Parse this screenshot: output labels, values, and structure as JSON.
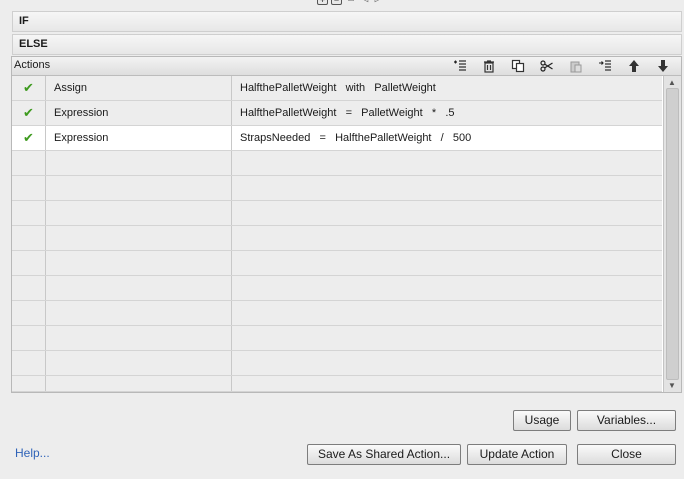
{
  "top_toolbar": {
    "icons": [
      "add-icon",
      "remove-icon",
      "copy-icon",
      "left-arrow-icon",
      "right-arrow-icon"
    ]
  },
  "sections": {
    "if_label": "IF",
    "else_label": "ELSE"
  },
  "actions": {
    "title": "Actions",
    "toolbar_icons": [
      "insert-action-icon",
      "delete-icon",
      "copy-icon",
      "cut-icon",
      "paste-icon",
      "insert-before-icon",
      "move-up-icon",
      "move-down-icon"
    ],
    "rows": [
      {
        "enabled": true,
        "type": "Assign",
        "detail": "HalfthePalletWeight   with   PalletWeight"
      },
      {
        "enabled": true,
        "type": "Expression",
        "detail": "HalfthePalletWeight   =   PalletWeight   *   .5"
      },
      {
        "enabled": true,
        "type": "Expression",
        "detail": "StrapsNeeded   =   HalfthePalletWeight   /   500"
      }
    ],
    "empty_row_count": 10
  },
  "buttons": {
    "usage": "Usage",
    "variables": "Variables...",
    "save_shared": "Save As Shared Action...",
    "update": "Update Action",
    "close": "Close"
  },
  "help_link": "Help...",
  "colors": {
    "check": "#3d9a1e",
    "link": "#2f63b8"
  }
}
